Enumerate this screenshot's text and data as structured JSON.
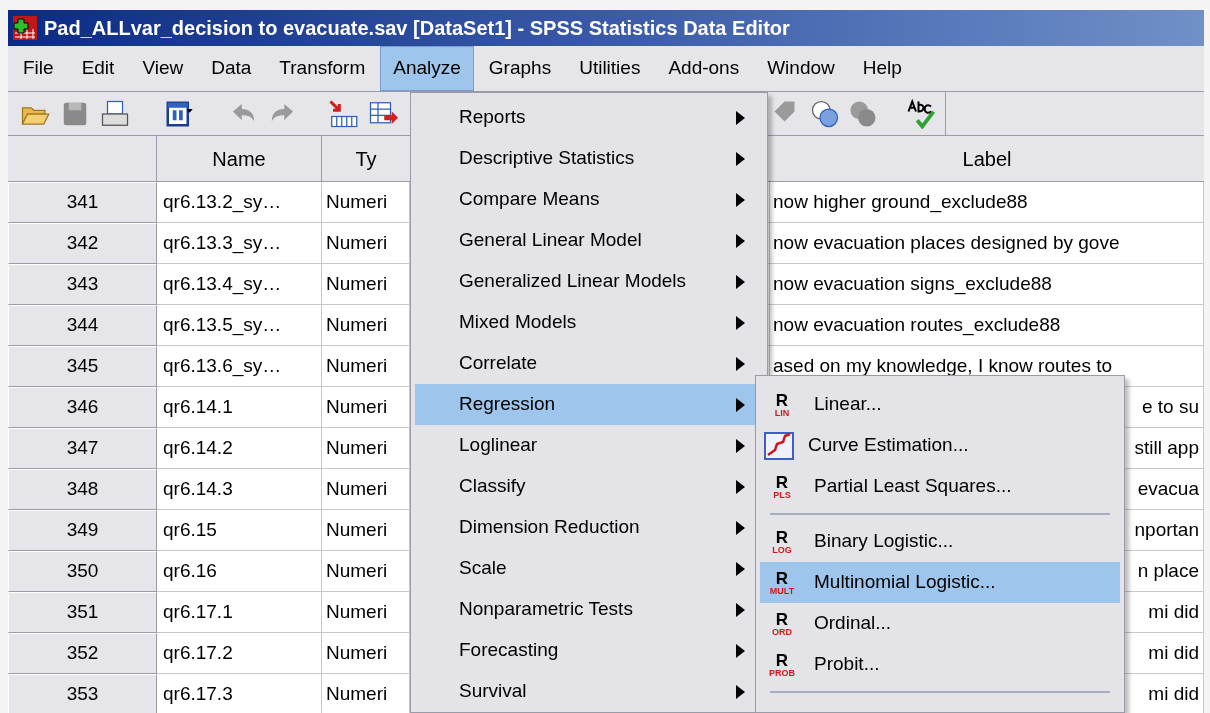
{
  "window": {
    "title": "Pad_ALLvar_decision to evacuate.sav [DataSet1] - SPSS Statistics Data Editor"
  },
  "menu_bar": [
    {
      "label": "File",
      "selected": false
    },
    {
      "label": "Edit",
      "selected": false
    },
    {
      "label": "View",
      "selected": false
    },
    {
      "label": "Data",
      "selected": false
    },
    {
      "label": "Transform",
      "selected": false
    },
    {
      "label": "Analyze",
      "selected": true
    },
    {
      "label": "Graphs",
      "selected": false
    },
    {
      "label": "Utilities",
      "selected": false
    },
    {
      "label": "Add-ons",
      "selected": false
    },
    {
      "label": "Window",
      "selected": false
    },
    {
      "label": "Help",
      "selected": false
    }
  ],
  "analyze_menu": {
    "items": [
      {
        "label": "Reports",
        "selected": false
      },
      {
        "label": "Descriptive Statistics",
        "selected": false
      },
      {
        "label": "Compare Means",
        "selected": false
      },
      {
        "label": "General Linear Model",
        "selected": false
      },
      {
        "label": "Generalized Linear Models",
        "selected": false
      },
      {
        "label": "Mixed Models",
        "selected": false
      },
      {
        "label": "Correlate",
        "selected": false
      },
      {
        "label": "Regression",
        "selected": true
      },
      {
        "label": "Loglinear",
        "selected": false
      },
      {
        "label": "Classify",
        "selected": false
      },
      {
        "label": "Dimension Reduction",
        "selected": false
      },
      {
        "label": "Scale",
        "selected": false
      },
      {
        "label": "Nonparametric Tests",
        "selected": false
      },
      {
        "label": "Forecasting",
        "selected": false
      },
      {
        "label": "Survival",
        "selected": false
      }
    ]
  },
  "regression_submenu": {
    "items": [
      {
        "kind": "badge",
        "icon_letter": "R",
        "icon_tag": "LIN",
        "label": "Linear...",
        "selected": false
      },
      {
        "kind": "curve",
        "label": "Curve Estimation...",
        "selected": false
      },
      {
        "kind": "badge",
        "icon_letter": "R",
        "icon_tag": "PLS",
        "label": "Partial Least Squares...",
        "selected": false
      },
      {
        "kind": "separator"
      },
      {
        "kind": "badge",
        "icon_letter": "R",
        "icon_tag": "LOG",
        "label": "Binary Logistic...",
        "selected": false
      },
      {
        "kind": "badge",
        "icon_letter": "R",
        "icon_tag": "MULT",
        "label": "Multinomial Logistic...",
        "selected": true
      },
      {
        "kind": "badge",
        "icon_letter": "R",
        "icon_tag": "ORD",
        "label": "Ordinal...",
        "selected": false
      },
      {
        "kind": "badge",
        "icon_letter": "R",
        "icon_tag": "PROB",
        "label": "Probit...",
        "selected": false
      },
      {
        "kind": "separator"
      }
    ]
  },
  "table": {
    "columns": [
      "Name",
      "Ty",
      "Label"
    ],
    "rows": [
      {
        "row": "341",
        "name": "qr6.13.2_sy…",
        "type": "Numeri",
        "label": "now higher ground_exclude88",
        "under_submenu": false
      },
      {
        "row": "342",
        "name": "qr6.13.3_sy…",
        "type": "Numeri",
        "label": "now evacuation places designed by gove",
        "under_submenu": false
      },
      {
        "row": "343",
        "name": "qr6.13.4_sy…",
        "type": "Numeri",
        "label": "now evacuation signs_exclude88",
        "under_submenu": false
      },
      {
        "row": "344",
        "name": "qr6.13.5_sy…",
        "type": "Numeri",
        "label": "now evacuation routes_exclude88",
        "under_submenu": false
      },
      {
        "row": "345",
        "name": "qr6.13.6_sy…",
        "type": "Numeri",
        "label": "ased on my knowledge, I know routes to",
        "under_submenu": false
      },
      {
        "row": "346",
        "name": "qr6.14.1",
        "type": "Numeri",
        "label": "e to su",
        "under_submenu": true
      },
      {
        "row": "347",
        "name": "qr6.14.2",
        "type": "Numeri",
        "label": "still app",
        "under_submenu": true
      },
      {
        "row": "348",
        "name": "qr6.14.3",
        "type": "Numeri",
        "label": "evacua",
        "under_submenu": true
      },
      {
        "row": "349",
        "name": "qr6.15",
        "type": "Numeri",
        "label": "nportan",
        "under_submenu": true
      },
      {
        "row": "350",
        "name": "qr6.16",
        "type": "Numeri",
        "label": "n place",
        "under_submenu": true
      },
      {
        "row": "351",
        "name": "qr6.17.1",
        "type": "Numeri",
        "label": "mi did",
        "under_submenu": true
      },
      {
        "row": "352",
        "name": "qr6.17.2",
        "type": "Numeri",
        "label": "mi did",
        "under_submenu": true
      },
      {
        "row": "353",
        "name": "qr6.17.3",
        "type": "Numeri",
        "label": "mi did",
        "under_submenu": true
      }
    ]
  }
}
